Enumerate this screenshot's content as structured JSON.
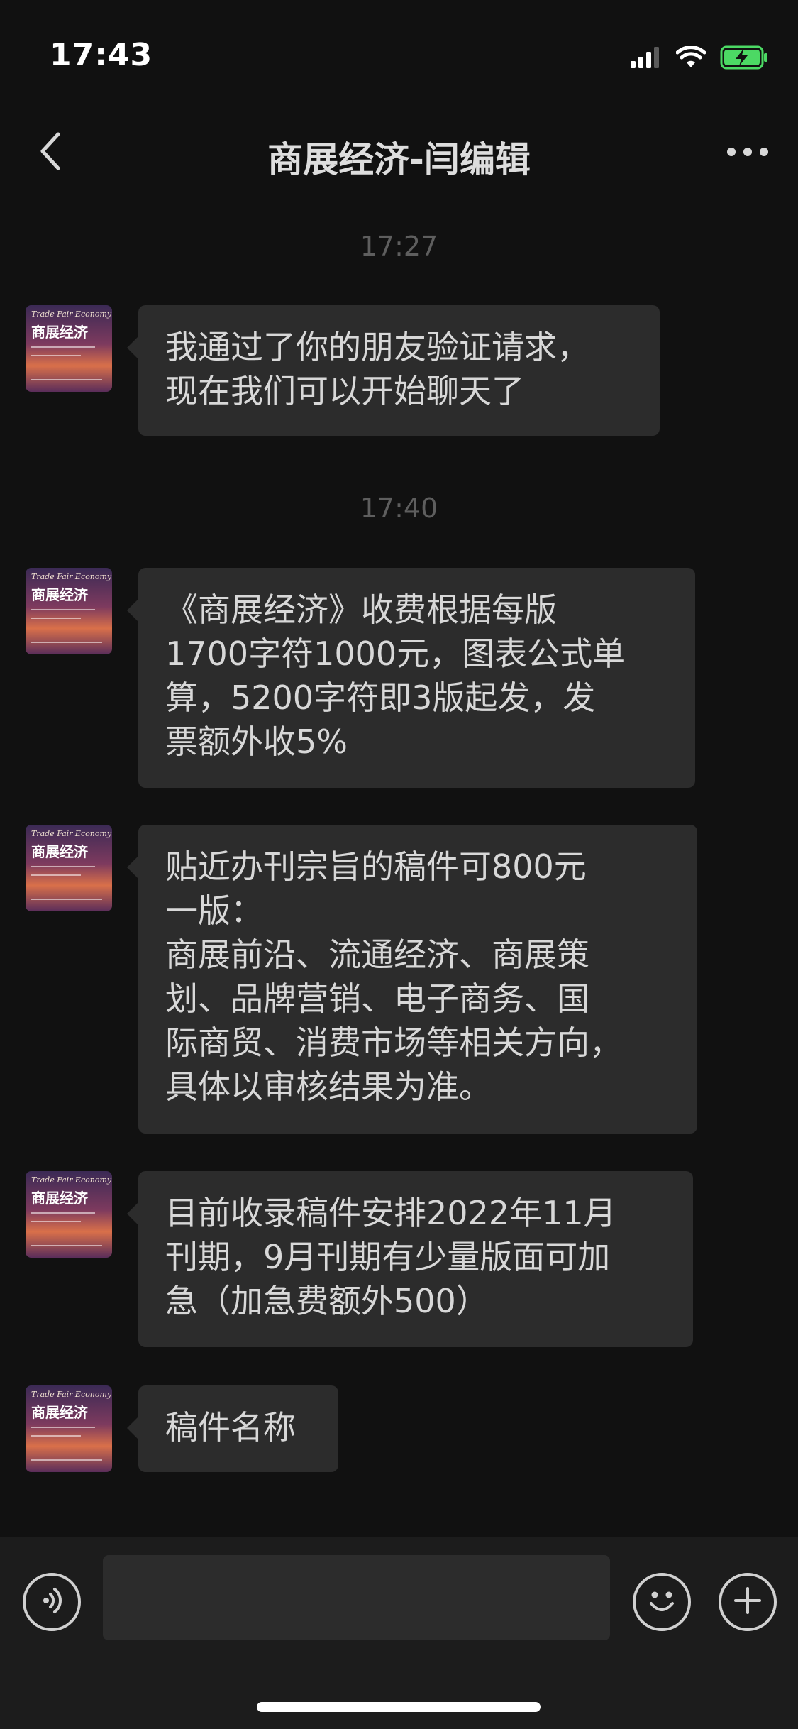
{
  "status_bar": {
    "time": "17:43",
    "signal_icon": "cellular-signal-icon",
    "wifi_icon": "wifi-icon",
    "battery_icon": "battery-charging-icon",
    "battery_color": "#4cd964"
  },
  "nav": {
    "title": "商展经济-闫编辑",
    "back_icon": "chevron-left-icon",
    "more_icon": "more-dots-icon"
  },
  "avatar": {
    "title_en": "Trade Fair Economy",
    "title_cn": "商展经济"
  },
  "timestamps": [
    "17:27",
    "17:40"
  ],
  "messages": [
    "我通过了你的朋友验证请求，\n现在我们可以开始聊天了",
    "《商展经济》收费根据每版\n1700字符1000元，图表公式单\n算，5200字符即3版起发，发\n票额外收5%",
    "贴近办刊宗旨的稿件可800元\n一版：\n商展前沿、流通经济、商展策\n划、品牌营销、电子商务、国\n际商贸、消费市场等相关方向，\n具体以审核结果为准。",
    "目前收录稿件安排2022年11月\n刊期，9月刊期有少量版面可加\n急（加急费额外500）",
    "稿件名称"
  ],
  "input_bar": {
    "voice_icon": "voice-input-icon",
    "text_value": "",
    "emoji_icon": "emoji-icon",
    "add_icon": "plus-icon"
  },
  "theme": {
    "background": "#111111",
    "bubble": "#2c2c2c",
    "input_bar": "#1c1c1c"
  }
}
